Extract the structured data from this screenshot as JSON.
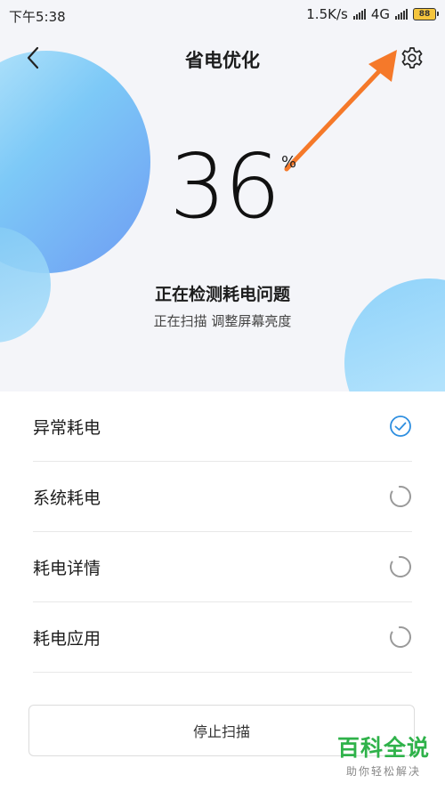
{
  "status_bar": {
    "time": "下午5:38",
    "net_speed": "1.5K/s",
    "network": "4G",
    "battery": "88"
  },
  "header": {
    "title": "省电优化"
  },
  "progress": {
    "value": "36",
    "unit": "%"
  },
  "scan": {
    "title": "正在检测耗电问题",
    "subtitle": "正在扫描 调整屏幕亮度"
  },
  "items": [
    {
      "label": "异常耗电",
      "state": "done"
    },
    {
      "label": "系统耗电",
      "state": "loading"
    },
    {
      "label": "耗电详情",
      "state": "loading"
    },
    {
      "label": "耗电应用",
      "state": "loading"
    }
  ],
  "stop_button": {
    "label": "停止扫描"
  },
  "watermark": {
    "main": "百科全说",
    "sub": "助你轻松解决"
  },
  "colors": {
    "accent": "#2d8ee0",
    "arrow": "#f5792a",
    "watermark": "#2fb24a"
  }
}
